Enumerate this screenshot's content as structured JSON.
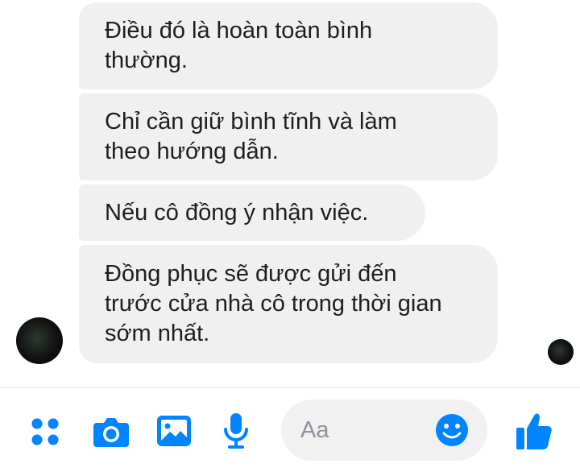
{
  "messages": [
    {
      "text": "Điều đó là hoàn toàn bình\nthường."
    },
    {
      "text": "Chỉ cần giữ bình tĩnh và làm\ntheo hướng dẫn."
    },
    {
      "text": "Nếu cô đồng ý nhận việc."
    },
    {
      "text": "Đồng phục sẽ được gửi đến\ntrước cửa nhà cô trong thời gian\nsớm nhất."
    }
  ],
  "composer": {
    "placeholder": "Aa",
    "icons": [
      "more-dots-icon",
      "camera-icon",
      "image-icon",
      "microphone-icon",
      "emoji-icon",
      "thumbs-up-icon"
    ]
  },
  "colors": {
    "accent": "#0084ff",
    "bubble": "#f1f0f0",
    "text": "#1c1e21",
    "input_bg": "#f1f1f1",
    "placeholder": "#8d949e"
  }
}
